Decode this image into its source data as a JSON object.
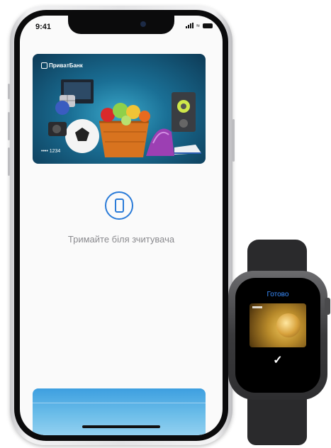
{
  "phone": {
    "status_bar": {
      "time": "9:41"
    },
    "card": {
      "bank_name": "ПриватБанк",
      "number_masked": "•••• 1234"
    },
    "reader_prompt": "Тримайте біля зчитувача"
  },
  "watch": {
    "status_title": "Готово",
    "confirm_symbol": "✓"
  },
  "colors": {
    "accent_blue": "#2a7bd8",
    "watch_title_blue": "#3a8dff",
    "card_teal": "#1a6f95"
  }
}
